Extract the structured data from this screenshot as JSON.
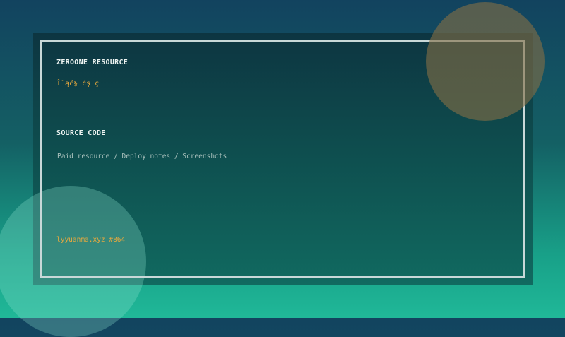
{
  "card": {
    "brand": "ZEROONE RESOURCE",
    "tagline": "Î˜ąč§ ćş ç",
    "section_title": "SOURCE CODE",
    "subtitle": "Paid resource / Deploy notes / Screenshots",
    "footer": "lyyuanma.xyz  #864"
  },
  "colors": {
    "accent": "#e8a93e",
    "frame": "#c8d8d8",
    "text": "#eef4f2"
  }
}
